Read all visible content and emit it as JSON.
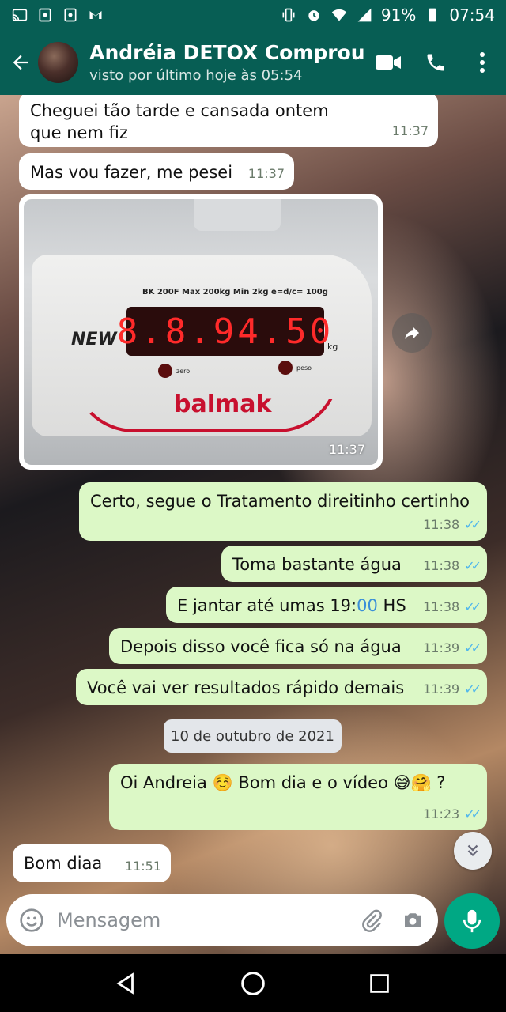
{
  "status_bar": {
    "battery": "91%",
    "clock": "07:54"
  },
  "header": {
    "title": "Andréia  DETOX Comprou",
    "subtitle": "visto por último hoje às 05:54"
  },
  "messages": [
    {
      "dir": "in",
      "text_line1": "Cheguei tão tarde e cansada ontem",
      "text_line2": "que nem fiz",
      "time": "11:37"
    },
    {
      "dir": "in",
      "text": "Mas vou fazer, me pesei",
      "time": "11:37"
    },
    {
      "dir": "out",
      "text": "Certo, segue o Tratamento direitinho certinho",
      "time": "11:38"
    },
    {
      "dir": "out",
      "text": "Toma bastante água",
      "time": "11:38"
    },
    {
      "dir": "out",
      "text_pre": "E jantar até umas 19:",
      "text_blue": "00",
      "text_post": " HS",
      "time": "11:38"
    },
    {
      "dir": "out",
      "text": "Depois disso você fica só na água",
      "time": "11:39"
    },
    {
      "dir": "out",
      "text": "Você vai ver resultados rápido demais",
      "time": "11:39"
    },
    {
      "dir": "out",
      "text": "Oi Andreia ☺️ Bom dia e o vídeo 😅🤗 ?",
      "time": "11:23"
    },
    {
      "dir": "in",
      "text": "Bom diaa",
      "time": "11:51"
    }
  ],
  "image_message": {
    "time": "11:37",
    "display_reading": "8.8.94.50",
    "model": "BK 200F   Max 200kg   Min 2kg   e=d/c= 100g",
    "badge": "NEW",
    "unit": "kg",
    "brand": "balmak",
    "zero_label": "zero",
    "peso_label": "peso"
  },
  "date_chip": "10 de outubro de 2021",
  "composer": {
    "placeholder": "Mensagem"
  },
  "colors": {
    "header": "#075e54",
    "outgoing": "#dcf8c6",
    "incoming": "#ffffff",
    "mic": "#00a884",
    "ticks": "#4fb6ec"
  }
}
